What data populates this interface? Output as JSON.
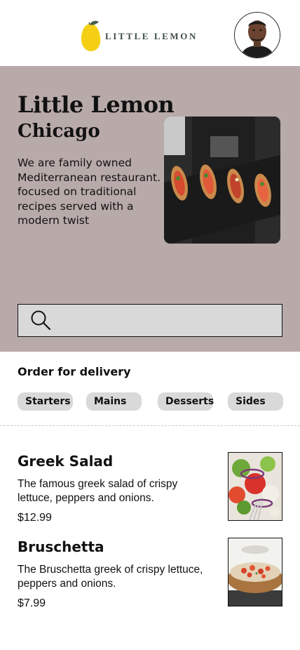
{
  "header": {
    "logo_text": "LITTLE LEMON",
    "logo_icon": "lemon-icon",
    "avatar": "user-avatar"
  },
  "hero": {
    "title": "Little Lemon",
    "subtitle": "Chicago",
    "description": "We are family owned Mediterranean restaurant. focused on traditional recipes served with a modern twist",
    "image": "bruschetta-platter-photo",
    "background_color": "#b9aaaa"
  },
  "search": {
    "icon": "search-icon"
  },
  "order": {
    "title": "Order for delivery",
    "categories": [
      "Starters",
      "Mains",
      "Desserts",
      "Sides"
    ]
  },
  "menu": {
    "items": [
      {
        "name": "Greek Salad",
        "description": "The famous greek salad of crispy lettuce, peppers and onions.",
        "price": "$12.99",
        "image": "greek-salad-photo"
      },
      {
        "name": "Bruschetta",
        "description": "The Bruschetta greek of crispy lettuce, peppers and onions.",
        "price": "$7.99",
        "image": "bruschetta-photo"
      }
    ]
  }
}
